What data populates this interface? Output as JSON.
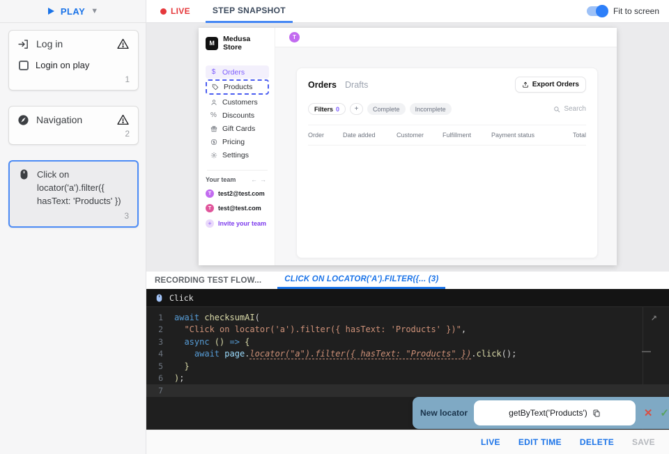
{
  "left_panel": {
    "play_label": "PLAY",
    "steps": {
      "login": {
        "title": "Log in",
        "checkbox_label": "Login on play",
        "index": "1"
      },
      "navigation": {
        "title": "Navigation",
        "index": "2"
      },
      "click": {
        "title": "Click on locator('a').filter({ hasText: 'Products' })",
        "index": "3"
      }
    }
  },
  "top_bar": {
    "live_label": "LIVE",
    "snapshot_tab_label": "STEP SNAPSHOT",
    "fit_to_screen_label": "Fit to screen",
    "fit_toggle_state": "on"
  },
  "snapshot": {
    "logo_letter": "M",
    "store_name": "Medusa Store",
    "topbar_avatar_letter": "T",
    "menu": [
      {
        "label": "Orders",
        "state": "active"
      },
      {
        "label": "Products",
        "state": "target-dashed"
      },
      {
        "label": "Customers",
        "state": "normal"
      },
      {
        "label": "Discounts",
        "state": "normal"
      },
      {
        "label": "Gift Cards",
        "state": "normal"
      },
      {
        "label": "Pricing",
        "state": "normal"
      },
      {
        "label": "Settings",
        "state": "normal"
      }
    ],
    "team": {
      "label": "Your team",
      "members": [
        {
          "email": "test2@test.com",
          "avatar_letter": "T"
        },
        {
          "email": "test@test.com",
          "avatar_letter": "T"
        }
      ],
      "invite_label": "Invite your team"
    },
    "orders_page": {
      "tab_active": "Orders",
      "tab_inactive": "Drafts",
      "export_label": "Export Orders",
      "filters_label": "Filters",
      "filters_count": "0",
      "plus_label": "+",
      "chips": {
        "complete": "Complete",
        "incomplete": "Incomplete"
      },
      "search_label": "Search",
      "columns": [
        "Order",
        "Date added",
        "Customer",
        "Fulfillment",
        "Payment status",
        "Total"
      ]
    }
  },
  "editor_tabs": {
    "recording_label": "RECORDING TEST FLOW...",
    "active_label": "CLICK ON LOCATOR('A').FILTER({... (3)"
  },
  "editor": {
    "header_label": "Click",
    "lines": [
      {
        "num": "1",
        "tokens": [
          {
            "c": "k",
            "t": "await "
          },
          {
            "c": "f",
            "t": "checksumAI"
          },
          {
            "c": "p",
            "t": "("
          }
        ]
      },
      {
        "num": "2",
        "tokens": [
          {
            "c": "p",
            "t": "  "
          },
          {
            "c": "s",
            "t": "\"Click on locator('a').filter({ hasText: 'Products' })\""
          },
          {
            "c": "p",
            "t": ","
          }
        ]
      },
      {
        "num": "3",
        "tokens": [
          {
            "c": "p",
            "t": "  "
          },
          {
            "c": "k",
            "t": "async"
          },
          {
            "c": "b",
            "t": " () "
          },
          {
            "c": "k",
            "t": "=>"
          },
          {
            "c": "b",
            "t": " {"
          }
        ]
      },
      {
        "num": "4",
        "tokens": [
          {
            "c": "p",
            "t": "    "
          },
          {
            "c": "k",
            "t": "await "
          },
          {
            "c": "v",
            "t": "page"
          },
          {
            "c": "p",
            "t": "."
          },
          {
            "c": "u",
            "t": "locator(\"a\").filter({ hasText: \"Products\" })"
          },
          {
            "c": "p",
            "t": "."
          },
          {
            "c": "f",
            "t": "click"
          },
          {
            "c": "p",
            "t": "();"
          }
        ]
      },
      {
        "num": "5",
        "tokens": [
          {
            "c": "b",
            "t": "  }"
          }
        ]
      },
      {
        "num": "6",
        "tokens": [
          {
            "c": "b",
            "t": ")"
          },
          {
            "c": "p",
            "t": ";"
          }
        ]
      },
      {
        "num": "7",
        "tokens": [],
        "current": true
      }
    ],
    "expand_icon_glyph": "↗"
  },
  "locator_popup": {
    "label": "New locator",
    "value": "getByText('Products')",
    "reject_glyph": "✕",
    "accept_glyph": "✓"
  },
  "bottom_bar": {
    "live_label": "LIVE",
    "edit_time_label": "EDIT TIME",
    "delete_label": "DELETE",
    "save_label": "SAVE",
    "save_state": "disabled"
  },
  "colors": {
    "accent_blue": "#1a73e8",
    "live_red": "#e5383b",
    "medusa_purple": "#7c5cfc",
    "popup_blue": "#7fa9c4",
    "editor_bg": "#1f1f1f",
    "selected_card_border": "#4c8bf5"
  }
}
